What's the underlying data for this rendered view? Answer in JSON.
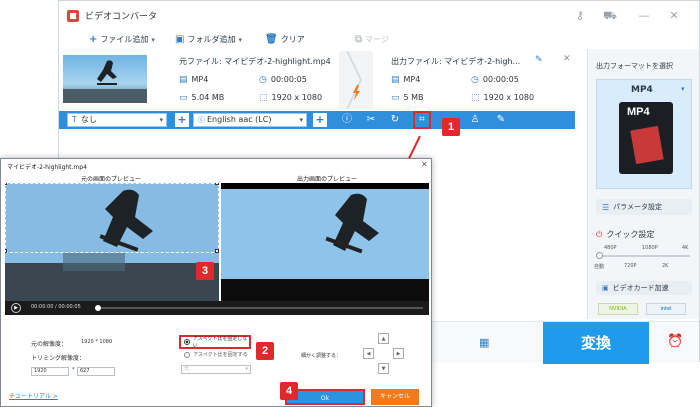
{
  "app": {
    "title": "ビデオコンバータ",
    "toolbar": {
      "add_file": "ファイル追加",
      "add_folder": "フォルダ追加",
      "clear": "クリア",
      "merge": "マージ"
    }
  },
  "file": {
    "source_label": "元ファイル: マイビデオ-2-highlight.mp4",
    "output_label": "出力ファイル: マイビデオ-2-high...",
    "source": {
      "format": "MP4",
      "duration": "00:00:05",
      "size": "5.04 MB",
      "resolution": "1920 x 1080"
    },
    "output": {
      "format": "MP4",
      "duration": "00:00:05",
      "size": "5 MB",
      "resolution": "1920 x 1080"
    }
  },
  "edit_bar": {
    "subtitle_value": "なし",
    "audio_value": "English aac (LC)"
  },
  "right_panel": {
    "format_title": "出力フォーマットを選択",
    "format_value": "MP4",
    "format_badge": "MP4",
    "param_button": "パラメータ設定",
    "quick_title": "クイック設定",
    "quality_top": [
      "480P",
      "1080P",
      "4K"
    ],
    "quality_bottom": [
      "自動",
      "720P",
      "2K"
    ],
    "gpu_label": "ビデオカード加速",
    "gpu_brands": [
      "NVIDIA",
      "intel"
    ]
  },
  "bottom": {
    "convert": "変換"
  },
  "dialog": {
    "title": "マイビデオ-2-highlight.mp4",
    "src_preview_label": "元の画面のプレビュー",
    "out_preview_label": "出力画面のプレビュー",
    "time": "00:00:00 / 00:00:05",
    "orig_res_label": "元の解像度：",
    "orig_res_value": "1920 * 1080",
    "trim_res_label": "トリミング解像度：",
    "trim_width": "1920",
    "trim_sep": "*",
    "trim_height": "627",
    "aspect_option_1": "アスペクト比を固定しない",
    "aspect_option_2": "アスペクト比を固定する",
    "aspect_select": "元",
    "fine_adjust": "細かく調整する：",
    "tutorial": "チュートリアル >",
    "ok": "Ok",
    "cancel": "キャンセル"
  },
  "annotations": [
    "1",
    "2",
    "3",
    "4"
  ],
  "colors": {
    "accent": "#2f8fdd",
    "convert": "#1e9bea",
    "cancel": "#f07a1c",
    "annotation": "#e0282d"
  }
}
